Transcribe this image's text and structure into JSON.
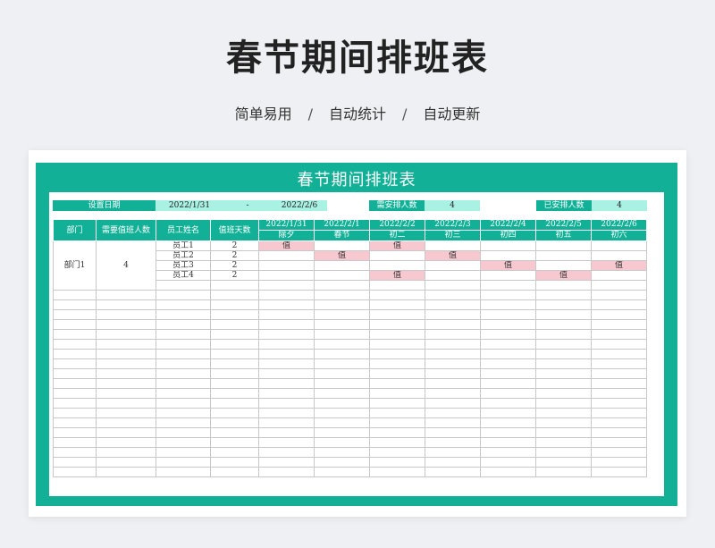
{
  "hero_title": "春节期间排班表",
  "taglines": [
    "简单易用",
    "自动统计",
    "自动更新"
  ],
  "tag_sep": "/",
  "sheet_title": "春节期间排班表",
  "config": {
    "date_label": "设置日期",
    "start_date": "2022/1/31",
    "dash": "-",
    "end_date": "2022/2/6",
    "need_label": "需安排人数",
    "need_value": "4",
    "arranged_label": "已安排人数",
    "arranged_value": "4"
  },
  "columns": {
    "dept": "部门",
    "need_count": "需要值班人数",
    "name": "员工姓名",
    "days": "值班天数"
  },
  "dates": [
    {
      "date": "2022/1/31",
      "day": "除夕"
    },
    {
      "date": "2022/2/1",
      "day": "春节"
    },
    {
      "date": "2022/2/2",
      "day": "初二"
    },
    {
      "date": "2022/2/3",
      "day": "初三"
    },
    {
      "date": "2022/2/4",
      "day": "初四"
    },
    {
      "date": "2022/2/5",
      "day": "初五"
    },
    {
      "date": "2022/2/6",
      "day": "初六"
    }
  ],
  "department": {
    "name": "部门1",
    "need": "4"
  },
  "employees": [
    {
      "name": "员工1",
      "days": "2",
      "duty": [
        "值",
        "",
        "值",
        "",
        "",
        "",
        ""
      ]
    },
    {
      "name": "员工2",
      "days": "2",
      "duty": [
        "",
        "值",
        "",
        "值",
        "",
        "",
        ""
      ]
    },
    {
      "name": "员工3",
      "days": "2",
      "duty": [
        "",
        "",
        "",
        "",
        "值",
        "",
        "值"
      ]
    },
    {
      "name": "员工4",
      "days": "2",
      "duty": [
        "",
        "",
        "值",
        "",
        "",
        "值",
        ""
      ]
    }
  ],
  "empty_rows": 19,
  "colors": {
    "accent": "#12b197",
    "light": "#a8f1e3",
    "duty": "#f8c8d0"
  }
}
